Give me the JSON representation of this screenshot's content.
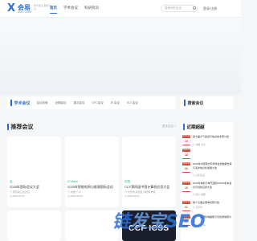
{
  "header": {
    "logo_mark": "X",
    "logo_text": "会易",
    "logo_sub": "HUIYI CONF",
    "slogan": "学术会议 服务平台",
    "nav": [
      {
        "label": "首页",
        "active": true
      },
      {
        "label": "学术会议",
        "active": false
      },
      {
        "label": "科研资讯",
        "active": false
      }
    ],
    "search_placeholder": "搜索你的会议",
    "login_label": "登录/注册"
  },
  "academic_bar": {
    "title": "学术会议",
    "categories": [
      "会议检索",
      "近期会议",
      "重点会议",
      "CFC会议",
      "EI 会议",
      "SCI 会议"
    ]
  },
  "search_conf_bar": {
    "title": "搜索会议"
  },
  "recommended": {
    "title": "推荐会议",
    "more": "更多会议 >",
    "cards": [
      {
        "tag": "会",
        "title": "2025年国际会议大会",
        "meta": "◎ 南京第三会议室",
        "meta2": "◎ 2025-05-02"
      },
      {
        "tag": "ICVision",
        "title": "2025年智能电网与能源国际会议",
        "meta": "◎ 中国 广州",
        "meta2": "◎ 2025-05-15"
      },
      {
        "tag": "中国",
        "title": "CCF第四届中国计算机应用大会",
        "meta": "◎ 北京市 海淀区 中国科学院",
        "meta2": "◎ 2025-06-01"
      }
    ],
    "bottom_label": "CCF ICSS"
  },
  "recent": {
    "title": "近期超越",
    "items": [
      {
        "year": "2025-06",
        "day": "15",
        "text": "第七届大气遥感与信息技术研讨会",
        "loc": "◎ 中国·北京"
      },
      {
        "year": "2025-06",
        "day": "18",
        "text": "",
        "loc": ""
      },
      {
        "year": "2025-06",
        "day": "20",
        "text": "2025年中国南方科学学会和数据仓库与海洋信息化发展大会",
        "loc": "◎ 山东青岛"
      },
      {
        "year": "2025-06",
        "day": "19",
        "text": "2025年电机与电气国际ROAD机车会议与创新应用大会",
        "loc": "◎ 四川·成都"
      },
      {
        "year": "2025-06",
        "day": "21",
        "text": "第十七届全国电机研讨会",
        "loc": "◎ 北京市"
      },
      {
        "year": "2025-06",
        "day": "22",
        "text": "第十一届国际电磁能与无线通信研讨会",
        "loc": "◎ 中国·上海"
      }
    ]
  },
  "watermark": {
    "part1": "链",
    "part2": "发宝",
    "part3": "SEO"
  },
  "colors": {
    "accent": "#2b6fd6",
    "badge": "#d44a3c",
    "tag": "#2bb39a"
  }
}
